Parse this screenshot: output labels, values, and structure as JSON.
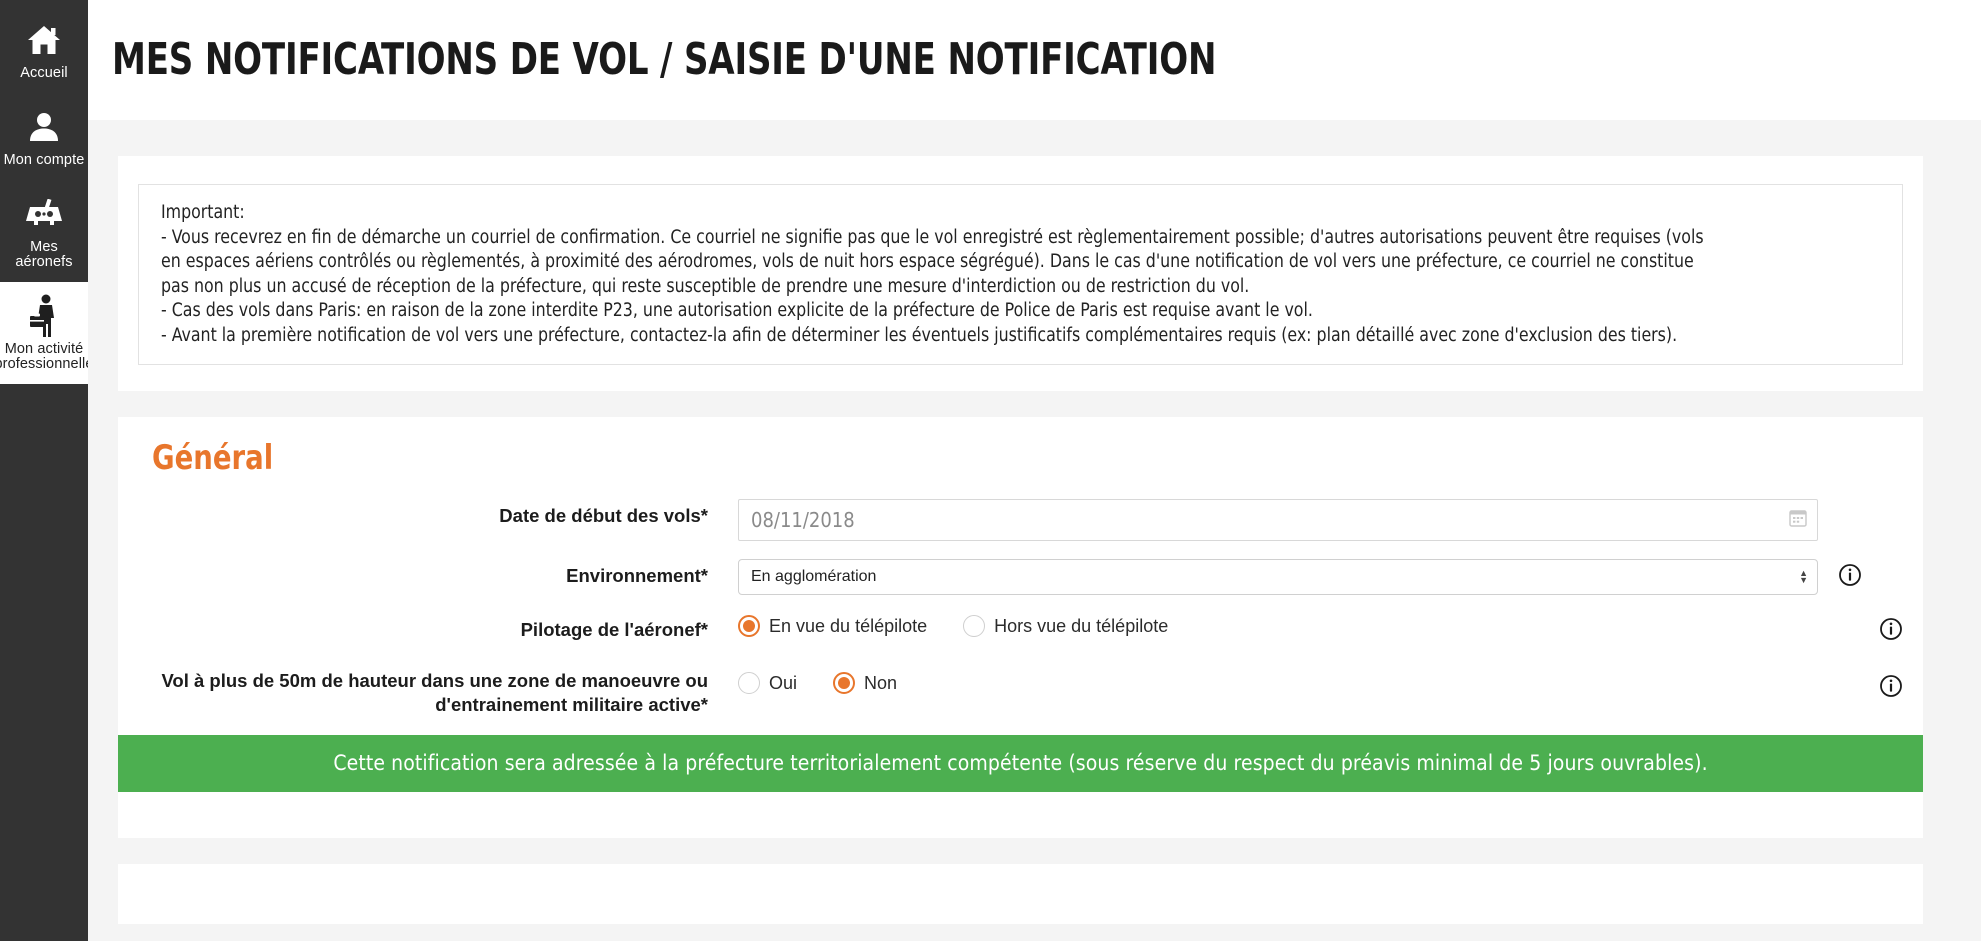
{
  "sidebar": {
    "items": [
      {
        "label": "Accueil",
        "icon": "home-icon",
        "active": false
      },
      {
        "label": "Mon compte",
        "icon": "person-icon",
        "active": false
      },
      {
        "label": "Mes aéronefs",
        "icon": "drone-icon",
        "active": false
      },
      {
        "label": "Mon activité\nprofessionnelle",
        "icon": "businessperson-icon",
        "active": true
      }
    ]
  },
  "header": {
    "title": "MES NOTIFICATIONS DE VOL / SAISIE D'UNE NOTIFICATION"
  },
  "notice": {
    "heading": "Important:",
    "lines": [
      "- Vous recevrez en fin de démarche un courriel de confirmation. Ce courriel ne signifie pas que le vol enregistré est règlementairement possible; d'autres autorisations peuvent être requises (vols",
      "en espaces aériens contrôlés ou règlementés, à proximité des aérodromes, vols de nuit hors espace ségrégué). Dans le cas d'une notification de vol vers une préfecture, ce courriel ne constitue",
      "pas non plus un accusé de réception de la préfecture, qui reste susceptible de prendre une mesure d'interdiction ou de restriction du vol.",
      "- Cas des vols dans Paris: en raison de la zone interdite P23, une autorisation explicite de la préfecture de Police de Paris est requise avant le vol.",
      "- Avant la première notification de vol vers une préfecture, contactez-la afin de déterminer les éventuels justificatifs complémentaires requis (ex: plan détaillé avec zone d'exclusion des tiers)."
    ]
  },
  "general": {
    "title": "Général",
    "date_field": {
      "label": "Date de début des vols*",
      "value": "08/11/2018",
      "icon": "calendar-icon"
    },
    "environment_field": {
      "label": "Environnement*",
      "value": "En agglomération",
      "info_icon": "info-icon"
    },
    "piloting_field": {
      "label": "Pilotage de l'aéronef*",
      "options": [
        {
          "label": "En vue du télépilote",
          "checked": true
        },
        {
          "label": "Hors vue du télépilote",
          "checked": false
        }
      ],
      "info_icon": "info-icon"
    },
    "altitude_field": {
      "label": "Vol à plus de 50m de hauteur dans une zone de manoeuvre ou d'entrainement militaire active*",
      "options": [
        {
          "label": "Oui",
          "checked": false
        },
        {
          "label": "Non",
          "checked": true
        }
      ],
      "info_icon": "info-icon"
    },
    "banner": "Cette notification sera adressée à la préfecture territorialement compétente (sous réserve du respect du préavis minimal de 5 jours ouvrables)."
  },
  "colors": {
    "accent_orange": "#e8762c",
    "sidebar_dark": "#333333",
    "banner_green": "#4caf50",
    "page_bg": "#f4f4f4"
  }
}
